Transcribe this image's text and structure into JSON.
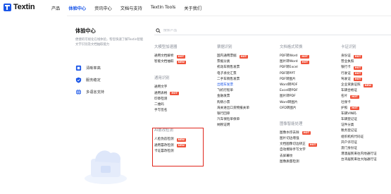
{
  "brand": {
    "name": "Textin"
  },
  "nav": {
    "items": [
      "产品",
      "体验中心",
      "资讯中心",
      "文档与支持",
      "TextIn Tools",
      "关于我们"
    ],
    "active": 1
  },
  "intro": {
    "title": "体验中心",
    "desc": "便捷的可视化在线体验，帮您快速了解Textin智能文字识别及文档抽取能力",
    "links": [
      "清晰率高",
      "服务稳定",
      "多语言支持"
    ]
  },
  "search": {
    "placeholder": "搜索产品"
  },
  "columns": {
    "c1": {
      "groups": [
        {
          "title": "大模型加速器",
          "items": [
            {
              "label": "通用文档解析",
              "badge": "HOT"
            },
            {
              "label": "智能文档抽取",
              "badge": "NEW"
            }
          ]
        },
        {
          "title": "通用识别",
          "items": [
            {
              "label": "通用文字"
            },
            {
              "label": "通用表格",
              "badge": "HOT"
            },
            {
              "label": "印章检测"
            },
            {
              "label": "二维码"
            },
            {
              "label": "手写签名"
            }
          ]
        },
        {
          "title": "AI篡改检测",
          "items": [
            {
              "label": "人脸伪造检测",
              "badge": "NEW"
            },
            {
              "label": "通用篡改检测",
              "badge": "NEW"
            },
            {
              "label": "卡证篡改检测"
            }
          ]
        }
      ]
    },
    "c2": {
      "title": "票据识别",
      "items": [
        {
          "label": "国内通用票据",
          "badge": "HOT"
        },
        {
          "label": "票据分类"
        },
        {
          "label": "机动车销售发票"
        },
        {
          "label": "电子承兑汇票"
        },
        {
          "label": "二手车销售发票"
        },
        {
          "label": "出租车发票",
          "hl": true
        },
        {
          "label": "飞机行程单"
        },
        {
          "label": "金融发票"
        },
        {
          "label": "购销小票"
        },
        {
          "label": "海关进出口货物报关单"
        },
        {
          "label": "银行回单"
        },
        {
          "label": "汽车保险单保单"
        },
        {
          "label": "纳税证明"
        }
      ]
    },
    "c3": {
      "groups": [
        {
          "title": "文档格式转换",
          "items": [
            {
              "label": "PDF转Word",
              "badge": "HOT"
            },
            {
              "label": "图片转Word",
              "badge": "HOT"
            },
            {
              "label": "PDF转Excel"
            },
            {
              "label": "PDF转PPT"
            },
            {
              "label": "PDF转图片"
            },
            {
              "label": "Word转PDF"
            },
            {
              "label": "Excel转PDF"
            },
            {
              "label": "图片转PDF"
            },
            {
              "label": "Word转图片"
            },
            {
              "label": "OFD转图片"
            }
          ]
        },
        {
          "title": "图像智能处理",
          "items": [
            {
              "label": "图像水印去除",
              "badge": "HOT"
            },
            {
              "label": "图片切边增强"
            },
            {
              "label": "文档图像切边矫正",
              "badge": "HOT"
            },
            {
              "label": "自动擦除手写文字"
            },
            {
              "label": "去屏幕纹"
            },
            {
              "label": "图像质量检测"
            }
          ]
        }
      ]
    },
    "c4": {
      "title": "卡证识别",
      "items": [
        {
          "label": "身份证",
          "badge": "HOT"
        },
        {
          "label": "营业执照"
        },
        {
          "label": "银行卡",
          "badge": "HOT"
        },
        {
          "label": "行驶证",
          "badge": "HOT"
        },
        {
          "label": "驾驶证",
          "badge": "HOT"
        },
        {
          "label": "企业资质证照",
          "badge": "NEW"
        },
        {
          "label": "车辆合格证"
        },
        {
          "label": "名片",
          "badge": "HOT"
        },
        {
          "label": "社保卡"
        },
        {
          "label": "护照",
          "badge": "HOT"
        },
        {
          "label": "车辆VIN码"
        },
        {
          "label": "车辆登记证"
        },
        {
          "label": "证件分类"
        },
        {
          "label": "税务登记证"
        },
        {
          "label": "组织机构代码证"
        },
        {
          "label": "开户许可证"
        },
        {
          "label": "澳门身份证"
        },
        {
          "label": "港澳居民来往内地通行证"
        },
        {
          "label": "台湾居民来往大陆通行证"
        }
      ]
    }
  },
  "colors": {
    "accent": "#1a56e8",
    "badge": "#f0523a",
    "highlight_box": "#e0271e"
  }
}
